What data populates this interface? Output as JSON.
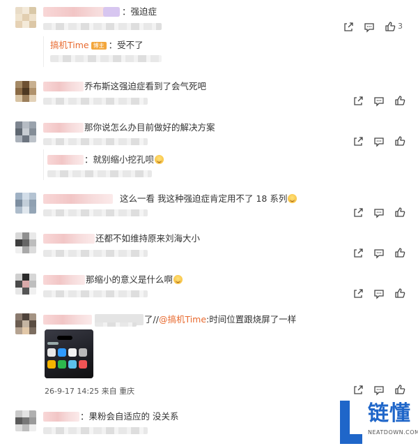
{
  "comments": [
    {
      "text": "：强迫症",
      "likes": "3"
    },
    {
      "reply": {
        "name": "搞机Time",
        "badge": "博主",
        "text": "：受不了"
      }
    },
    {
      "text": "乔布斯这强迫症看到了会气死吧"
    },
    {
      "text": "那你说怎么办目前做好的解决方案"
    },
    {
      "reply": {
        "text": "：就别缩小挖孔呗"
      }
    },
    {
      "text": "这么一看 我这种强迫症肯定用不了 18 系列"
    },
    {
      "text": "还都不如维持原来刘海大小"
    },
    {
      "text": "那缩小的意义是什么啊"
    },
    {
      "text_prefix": "了//",
      "mention": "@搞机Time",
      "text_suffix": ":时间位置跟烧屏了一样",
      "meta": "26-9-17 14:25 来自 重庆"
    },
    {
      "text": "：果粉会自适应的 没关系"
    }
  ],
  "watermark": {
    "glyph": "L",
    "title": "链懂",
    "domain": "NEATDOWN.COM"
  },
  "colors": {
    "accent": "#e86a2f",
    "logo_blue": "#1f66c9"
  }
}
